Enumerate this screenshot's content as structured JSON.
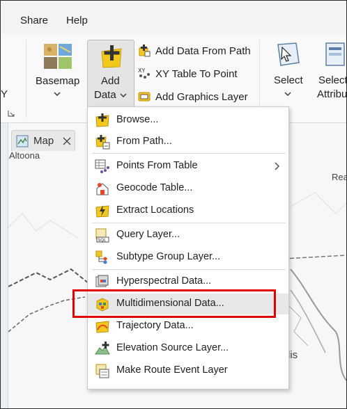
{
  "menubar": {
    "tabs": [
      "Share",
      "Help"
    ]
  },
  "ribbon": {
    "basemap_label": "Basemap",
    "add_data_line1": "Add",
    "add_data_line2": "Data",
    "add_data_from_path": "Add Data From Path",
    "xy_table_to_point": "XY Table To Point",
    "add_graphics_layer": "Add Graphics Layer",
    "select_label": "Select",
    "select_by_attributes_partial": "Select",
    "attributes_partial": "Attribu",
    "edge_y": "Y"
  },
  "map": {
    "tab_label": "Map",
    "place_altoona": "Altoona",
    "place_rea": "Rea",
    "place_lis": "lis"
  },
  "menu": {
    "items": [
      {
        "label": "Browse...",
        "icon": "browse-icon"
      },
      {
        "label": "From Path...",
        "icon": "from-path-icon"
      },
      {
        "label": "Points From Table",
        "icon": "points-from-table-icon",
        "submenu": true
      },
      {
        "label": "Geocode Table...",
        "icon": "geocode-table-icon"
      },
      {
        "label": "Extract Locations",
        "icon": "extract-locations-icon"
      },
      {
        "label": "Query Layer...",
        "icon": "query-layer-icon"
      },
      {
        "label": "Subtype Group Layer...",
        "icon": "subtype-group-layer-icon"
      },
      {
        "label": "Hyperspectral Data...",
        "icon": "hyperspectral-data-icon"
      },
      {
        "label": "Multidimensional Data...",
        "icon": "multidimensional-data-icon",
        "highlighted": true
      },
      {
        "label": "Trajectory Data...",
        "icon": "trajectory-data-icon"
      },
      {
        "label": "Elevation Source Layer...",
        "icon": "elevation-source-layer-icon"
      },
      {
        "label": "Make Route Event Layer",
        "icon": "make-route-event-layer-icon"
      }
    ]
  },
  "colors": {
    "highlight_box": "#e00000",
    "menu_hover": "#e8e8e8",
    "icon_yellow": "#f2c81c"
  }
}
